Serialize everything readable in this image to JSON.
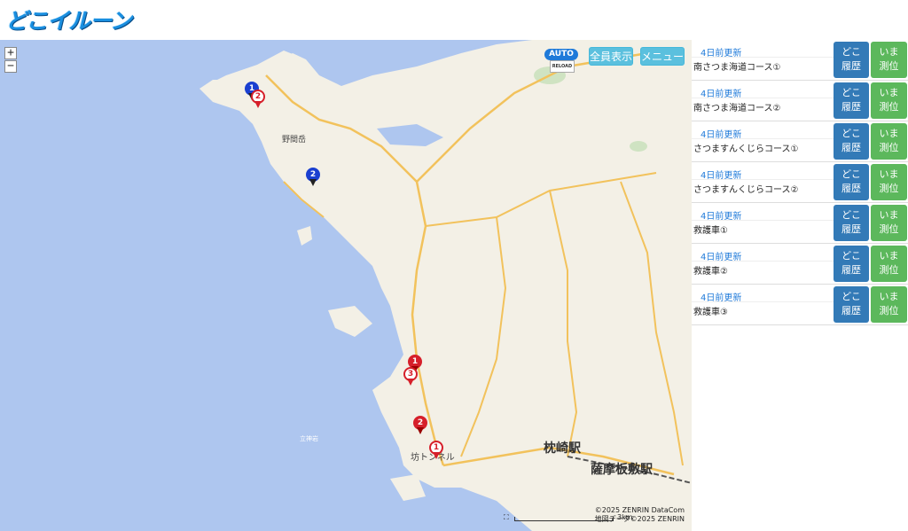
{
  "app": {
    "logo_text": "どこイルーン"
  },
  "map": {
    "zoom_in": "+",
    "zoom_out": "−",
    "auto_reload": {
      "top": "AUTO",
      "bottom": "RELOAD"
    },
    "show_all_label": "全員表示",
    "menu_label": "メニュー",
    "places": {
      "mountain": "野間岳",
      "tunnel": "坊トンネル",
      "cape": "立神岩"
    },
    "stations": {
      "makurazaki": "枕崎駅",
      "satsumaitashiki": "薩摩板敷駅"
    },
    "scale_label": "3km",
    "copyright_line1": "©2025 ZENRIN DataCom",
    "copyright_line2": "地図データ©2025 ZENRIN",
    "markers": [
      {
        "label": "1",
        "style": "blue"
      },
      {
        "label": "2",
        "style": "white"
      },
      {
        "label": "2",
        "style": "blue"
      },
      {
        "label": "1",
        "style": "red"
      },
      {
        "label": "3",
        "style": "white"
      },
      {
        "label": "2",
        "style": "red"
      },
      {
        "label": "1",
        "style": "white"
      }
    ]
  },
  "panel": {
    "rows": [
      {
        "updated": "4日前更新",
        "name": "南さつま海道コース①",
        "doko_line1": "どこ",
        "doko_line2": "履歴",
        "ima_line1": "いま",
        "ima_line2": "測位"
      },
      {
        "updated": "4日前更新",
        "name": "南さつま海道コース②",
        "doko_line1": "どこ",
        "doko_line2": "履歴",
        "ima_line1": "いま",
        "ima_line2": "測位"
      },
      {
        "updated": "4日前更新",
        "name": "さつますんくじらコース①",
        "doko_line1": "どこ",
        "doko_line2": "履歴",
        "ima_line1": "いま",
        "ima_line2": "測位"
      },
      {
        "updated": "4日前更新",
        "name": "さつますんくじらコース②",
        "doko_line1": "どこ",
        "doko_line2": "履歴",
        "ima_line1": "いま",
        "ima_line2": "測位"
      },
      {
        "updated": "4日前更新",
        "name": "救護車①",
        "doko_line1": "どこ",
        "doko_line2": "履歴",
        "ima_line1": "いま",
        "ima_line2": "測位"
      },
      {
        "updated": "4日前更新",
        "name": "救護車②",
        "doko_line1": "どこ",
        "doko_line2": "履歴",
        "ima_line1": "いま",
        "ima_line2": "測位"
      },
      {
        "updated": "4日前更新",
        "name": "救護車③",
        "doko_line1": "どこ",
        "doko_line2": "履歴",
        "ima_line1": "いま",
        "ima_line2": "測位"
      }
    ]
  },
  "colors": {
    "sea": "#aec6ef",
    "land": "#f3f0e6",
    "road": "#f2c25c",
    "blue_button": "#337ab7",
    "green_button": "#5cb85c",
    "info_button": "#5bc0de"
  }
}
